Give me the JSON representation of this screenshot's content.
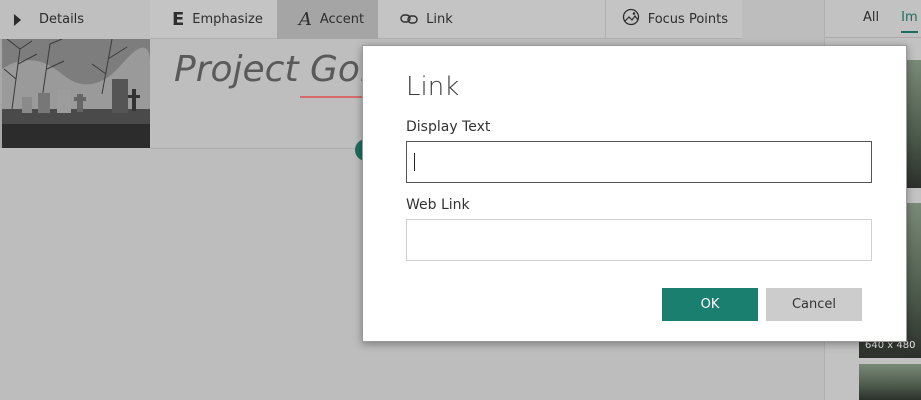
{
  "left_panel": {
    "details_label": "Details"
  },
  "toolbar": {
    "emphasize": {
      "glyph": "E",
      "label": "Emphasize"
    },
    "accent": {
      "glyph": "A",
      "label": "Accent"
    },
    "link": {
      "label": "Link"
    },
    "focus_points": {
      "label": "Focus Points"
    }
  },
  "editor": {
    "title": "Project Gor"
  },
  "right_panel": {
    "tabs": [
      "All",
      "Im"
    ],
    "image_size": "640 x 480"
  },
  "dialog": {
    "title": "Link",
    "display_text_label": "Display Text",
    "display_text_value": "",
    "web_link_label": "Web Link",
    "web_link_value": "",
    "ok_label": "OK",
    "cancel_label": "Cancel"
  },
  "colors": {
    "accent": "#1a7f6e",
    "cancel_bg": "#cccccc",
    "overlay": "#bdbdbd"
  }
}
